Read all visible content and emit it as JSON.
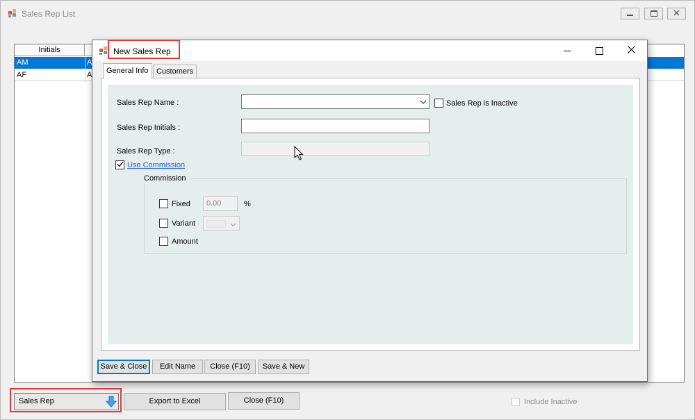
{
  "parent": {
    "title": "Sales Rep List",
    "grid": {
      "column_header": "Initials",
      "rows": [
        {
          "initials": "AM",
          "col2": "A",
          "selected": true
        },
        {
          "initials": "AF",
          "col2": "A",
          "selected": false
        }
      ]
    },
    "footer": {
      "dropdown_label": "Sales Rep",
      "export_label": "Export to Excel",
      "close_label": "Close (F10)",
      "include_inactive_label": "Include Inactive"
    },
    "window_buttons": [
      "minimize-icon",
      "restore-icon",
      "close-icon"
    ]
  },
  "dialog": {
    "title": "New Sales Rep",
    "tabs": [
      {
        "label": "General Info",
        "active": true
      },
      {
        "label": "Customers",
        "active": false
      }
    ],
    "form": {
      "name_label": "Sales Rep Name :",
      "name_value": "",
      "inactive_label": "Sales Rep is Inactive",
      "inactive_checked": false,
      "initials_label": "Sales Rep Initials :",
      "initials_value": "",
      "type_label": "Sales Rep Type :",
      "type_value": "",
      "use_commission_label": "Use Commission",
      "use_commission_checked": true
    },
    "commission": {
      "group_label": "Commission",
      "fixed_label": "Fixed",
      "fixed_value": "0.00",
      "fixed_unit": "%",
      "variant_label": "Variant",
      "amount_label": "Amount"
    },
    "buttons": {
      "save_close": "Save & Close",
      "edit_name": "Edit Name",
      "close": "Close (F10)",
      "save_new": "Save & New"
    }
  },
  "colors": {
    "selection": "#0078d7",
    "highlight_border": "#e0393e",
    "link": "#2062d6",
    "panel_bg": "#e6eded"
  }
}
